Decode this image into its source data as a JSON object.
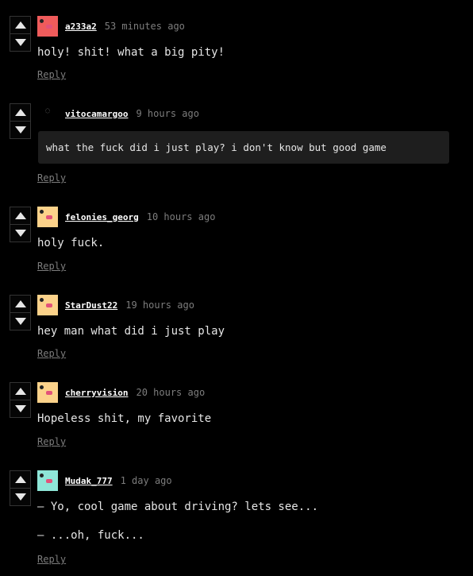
{
  "reply_label": "Reply",
  "comments": [
    {
      "user": "a233a2",
      "time": "53 minutes ago",
      "lines": [
        "holy! shit! what a big pity!"
      ],
      "avatar_color": "#ef5b5b"
    },
    {
      "user": "vitocamargoo",
      "time": "9 hours ago",
      "lines": [
        "what the fuck did i just play? i don't know but good game"
      ],
      "avatar_color": "",
      "avatar_placeholder": "◌"
    },
    {
      "user": "felonies_georg",
      "time": "10 hours ago",
      "lines": [
        "holy fuck."
      ],
      "avatar_color": "#fcd28a"
    },
    {
      "user": "StarDust22",
      "time": "19 hours ago",
      "lines": [
        "hey man what did i just play"
      ],
      "avatar_color": "#fcd28a"
    },
    {
      "user": "cherryvision",
      "time": "20 hours ago",
      "lines": [
        "Hopeless shit, my favorite"
      ],
      "avatar_color": "#fcd28a"
    },
    {
      "user": "Mudak_777",
      "time": "1 day ago",
      "lines": [
        "— Yo, cool game about driving? lets see...",
        "— ...oh, fuck..."
      ],
      "avatar_color": "#8ee6d8"
    }
  ]
}
